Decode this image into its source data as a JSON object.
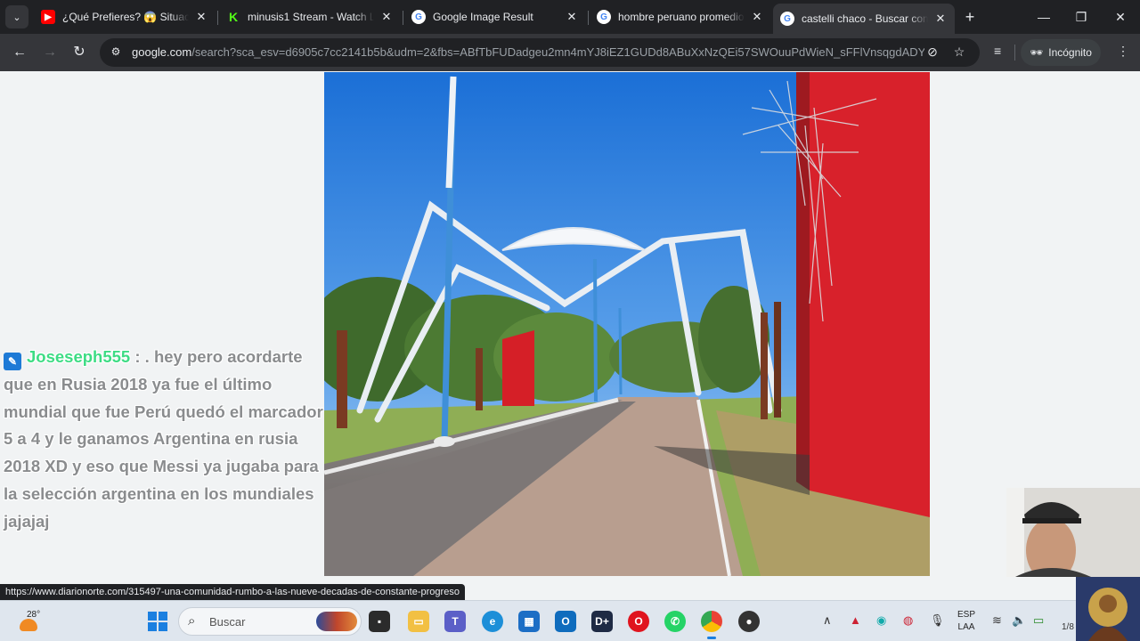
{
  "browser": {
    "tabs": [
      {
        "title": "¿Qué Prefieres? 😱 Situacio",
        "favicon": "youtube-icon",
        "active": false
      },
      {
        "title": "minusis1 Stream - Watch Liv",
        "favicon": "kick-icon",
        "active": false
      },
      {
        "title": "Google Image Result",
        "favicon": "google-icon",
        "active": false
      },
      {
        "title": "hombre peruano promedio",
        "favicon": "google-icon",
        "active": false
      },
      {
        "title": "castelli chaco - Buscar con G",
        "favicon": "google-icon",
        "active": true
      }
    ],
    "new_tab_label": "+",
    "url_host": "google.com",
    "url_rest": "/search?sca_esv=d6905c7cc2141b5b&udm=2&fbs=ABfTbFUDadgeu2mn4mYJ8iEZ1GUDd8ABuXxNzQEi57SWOuuPdWieN_sFFlVnsqgdADY...",
    "incognito_label": "Incógnito"
  },
  "page": {
    "chat": {
      "username": "Joseseph555",
      "separator": ":",
      "message": ". hey pero acordarte que en Rusia 2018 ya fue el último mundial que fue Perú quedó el marcador 5 a 4 y le ganamos Argentina en rusia 2018 XD y eso que Messi ya jugaba para la selección argentina en los mundiales jajajaj"
    },
    "status_url": "https://www.diarionorte.com/315497-una-comunidad-rumbo-a-las-nueve-decadas-de-constante-progreso"
  },
  "taskbar": {
    "weather_temp": "28°",
    "search_placeholder": "Buscar",
    "lang_line1": "ESP",
    "lang_line2": "LAA",
    "clock": "1/8"
  }
}
